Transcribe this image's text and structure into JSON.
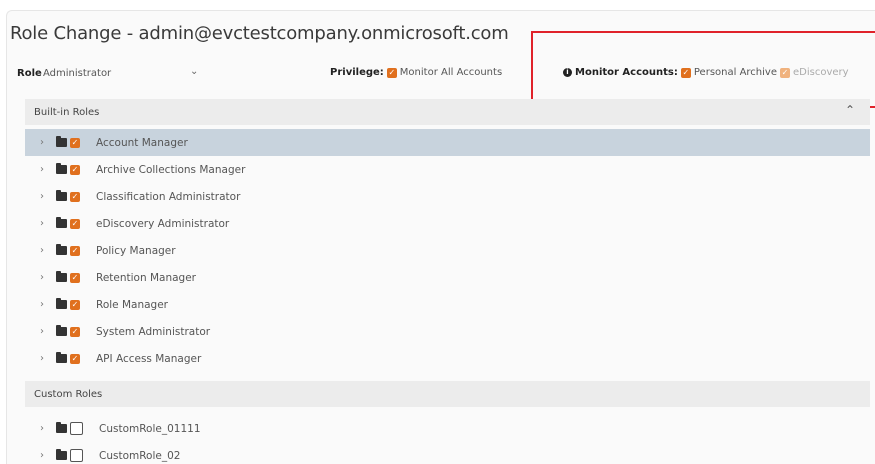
{
  "title": "Role Change - admin@evctestcompany.onmicrosoft.com",
  "toolbar": {
    "role_label": "Role",
    "role_value": "Administrator",
    "privilege_label": "Privilege:",
    "privilege_option": "Monitor All Accounts",
    "monitor_label": "Monitor Accounts:",
    "monitor_option_1": "Personal Archive",
    "monitor_option_2": "eDiscovery"
  },
  "builtin": {
    "header": "Built-in Roles",
    "roles": [
      {
        "label": "Account Manager",
        "checked": true,
        "selected": true
      },
      {
        "label": "Archive Collections Manager",
        "checked": true
      },
      {
        "label": "Classification Administrator",
        "checked": true
      },
      {
        "label": "eDiscovery Administrator",
        "checked": true
      },
      {
        "label": "Policy Manager",
        "checked": true
      },
      {
        "label": "Retention Manager",
        "checked": true
      },
      {
        "label": "Role Manager",
        "checked": true
      },
      {
        "label": "System Administrator",
        "checked": true
      },
      {
        "label": "API Access Manager",
        "checked": true
      }
    ]
  },
  "custom": {
    "header": "Custom Roles",
    "roles": [
      {
        "label": "CustomRole_01111",
        "checked": false
      },
      {
        "label": "CustomRole_02",
        "checked": false
      }
    ]
  },
  "colors": {
    "accent": "#e0701e",
    "highlight_border": "#e0222a",
    "selected_row": "#c8d3dd"
  }
}
